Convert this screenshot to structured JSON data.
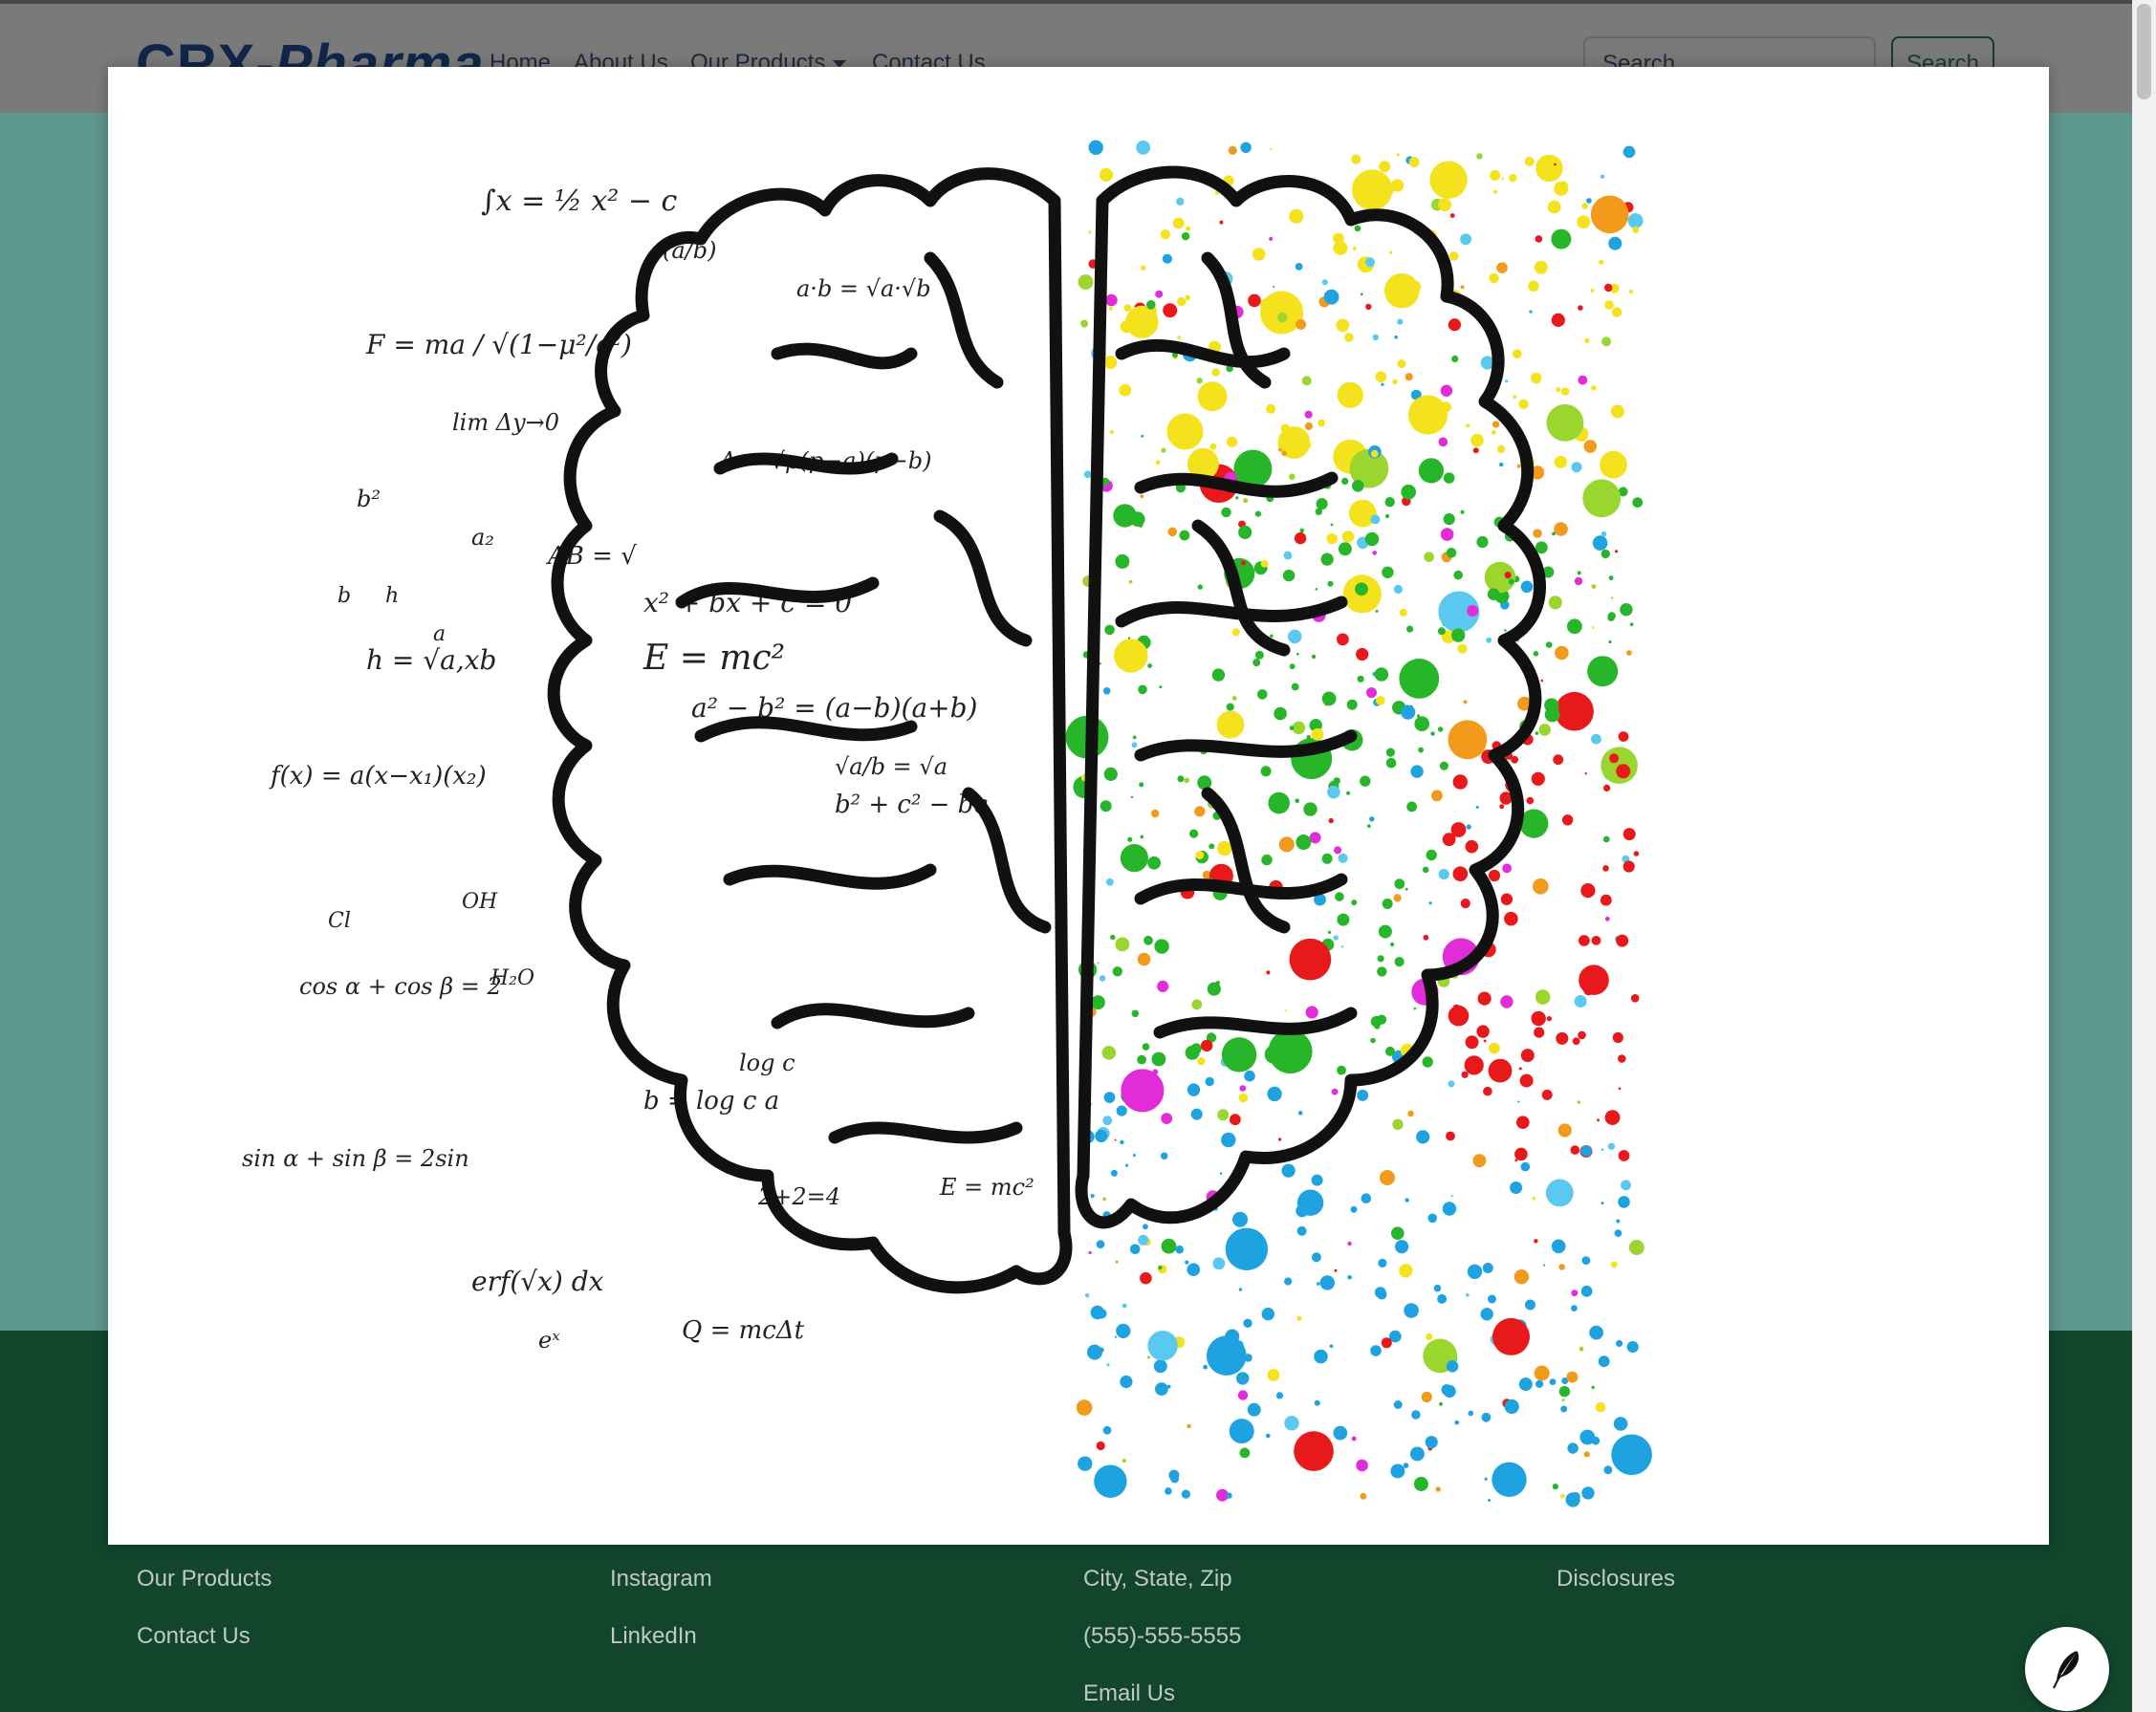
{
  "navbar": {
    "brand_main": "CRX-",
    "brand_italic": "Pharma",
    "links": [
      "Home",
      "About Us",
      "Our Products",
      "Contact Us"
    ],
    "search_placeholder": "Search",
    "search_button": "Search"
  },
  "footer": {
    "col1": [
      "Our Products",
      "Contact Us"
    ],
    "col2": [
      "Instagram",
      "LinkedIn"
    ],
    "col3": [
      "City, State, Zip",
      "(555)-555-5555",
      "Email Us"
    ],
    "col4": [
      "Disclosures"
    ]
  },
  "modal": {
    "image": "brain-illustration",
    "equations": [
      "∫x = ½ x² − c",
      "F = ma / √(1−μ²/c²)",
      "lim Δy→0",
      "AB = √",
      "h = √a,xb",
      "f(x) = a(x−x₁)(x₂)",
      "cos α + cos β = 2",
      "sin α + sin β = 2sin",
      "erf(√x) dx",
      "eˣ",
      "E = mc²",
      "a² − b² = (a−b)(a+b)",
      "Q = mcΔt",
      "log c",
      "b = log c a",
      "2+2=4",
      "E = mc²",
      "(a/b)",
      "a·b = √a·√b",
      "A = √p(p−a)(p−b)",
      "x² + bx + c = 0",
      "b² + c² − bc",
      "√a/b = √a",
      "OH",
      "Cl",
      "H₂O",
      "b²",
      "a₂",
      "b",
      "h",
      "a"
    ]
  },
  "fab": {
    "icon": "feather-icon"
  }
}
